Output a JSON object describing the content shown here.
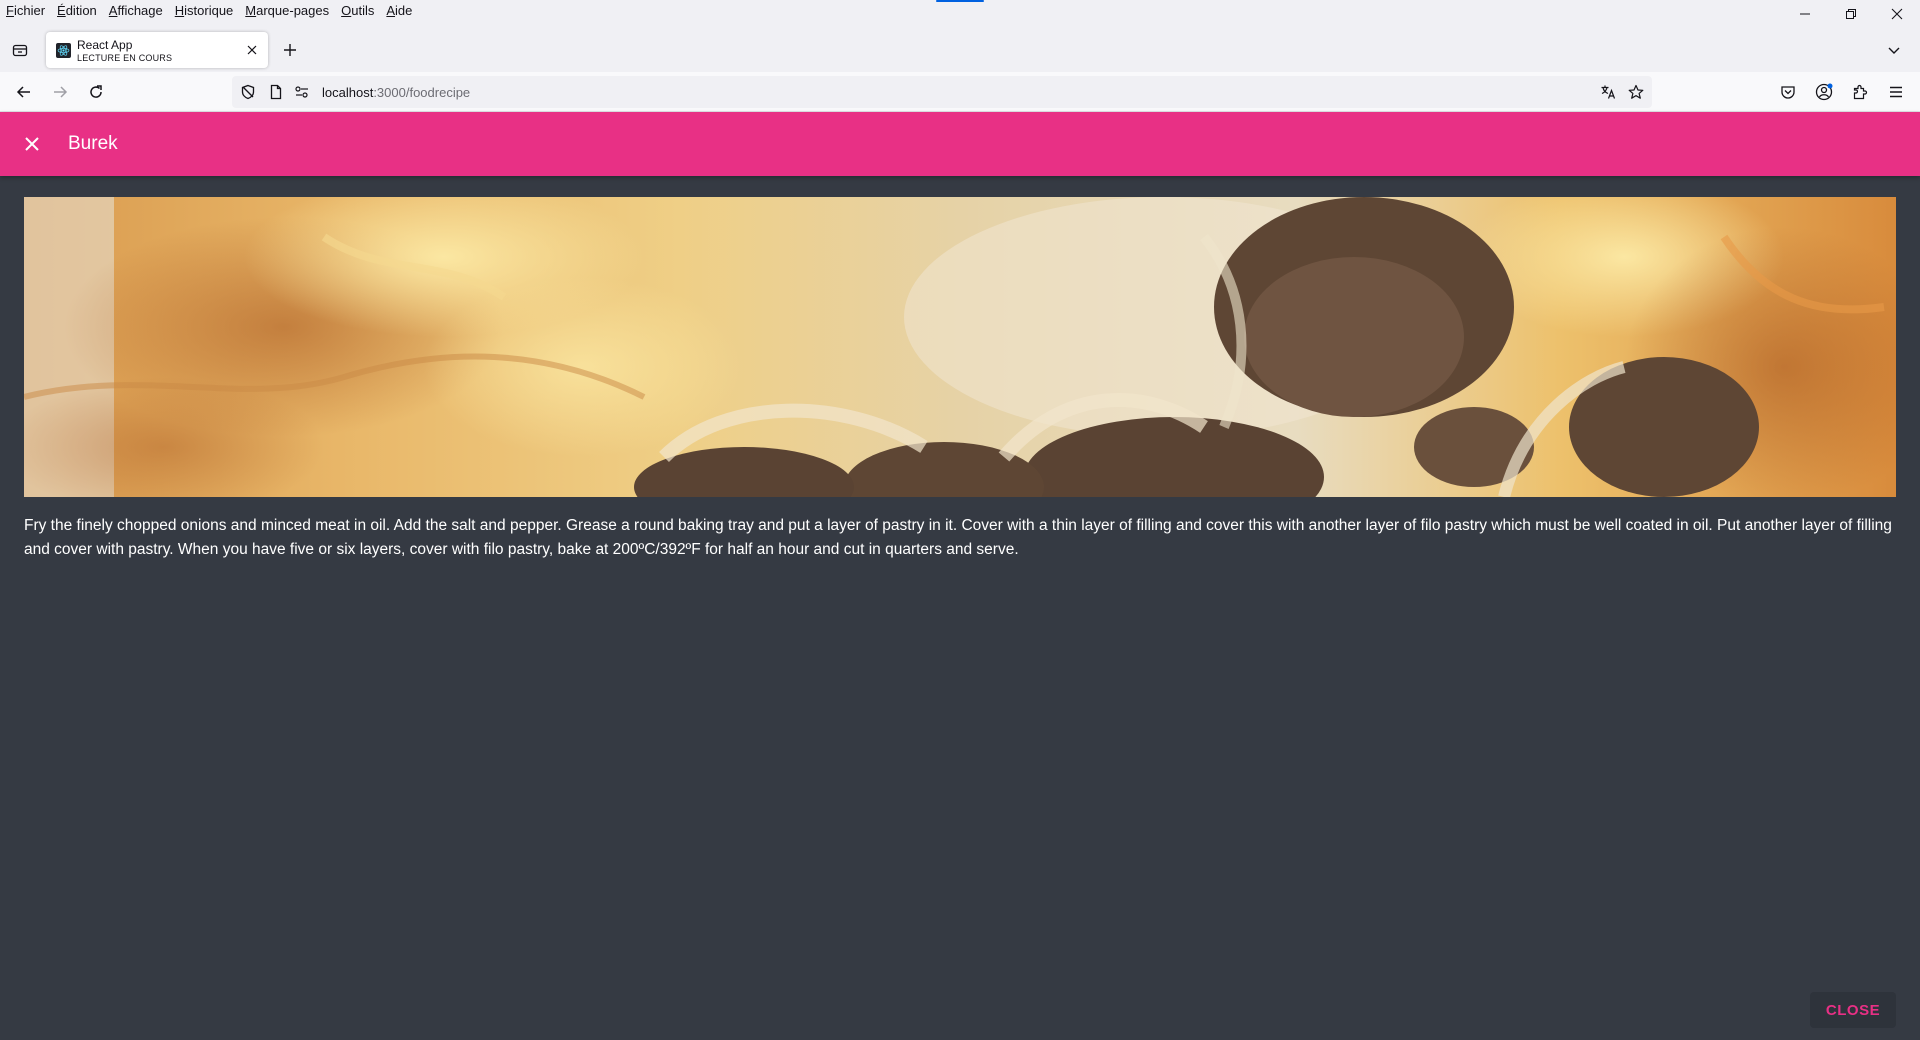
{
  "menubar": {
    "items": [
      {
        "accel": "F",
        "rest": "ichier"
      },
      {
        "accel": "É",
        "rest": "dition"
      },
      {
        "accel": "A",
        "rest": "ffichage"
      },
      {
        "accel": "H",
        "rest": "istorique"
      },
      {
        "accel": "M",
        "rest": "arque-pages"
      },
      {
        "accel": "O",
        "rest": "utils"
      },
      {
        "accel": "A",
        "rest": "ide"
      }
    ]
  },
  "tab": {
    "title": "React App",
    "subtitle": "LECTURE EN COURS"
  },
  "urlbar": {
    "host": "localhost",
    "path": ":3000/foodrecipe"
  },
  "appbar": {
    "title": "Burek"
  },
  "recipe": {
    "description": "Fry the finely chopped onions and minced meat in oil. Add the salt and pepper. Grease a round baking tray and put a layer of pastry in it. Cover with a thin layer of filling and cover this with another layer of filo pastry which must be well coated in oil. Put another layer of filling and cover with pastry. When you have five or six layers, cover with filo pastry, bake at 200ºC/392ºF for half an hour and cut in quarters and serve."
  },
  "footer": {
    "close_label": "CLOSE"
  },
  "colors": {
    "accent": "#e83085",
    "page_background": "#353a43"
  }
}
